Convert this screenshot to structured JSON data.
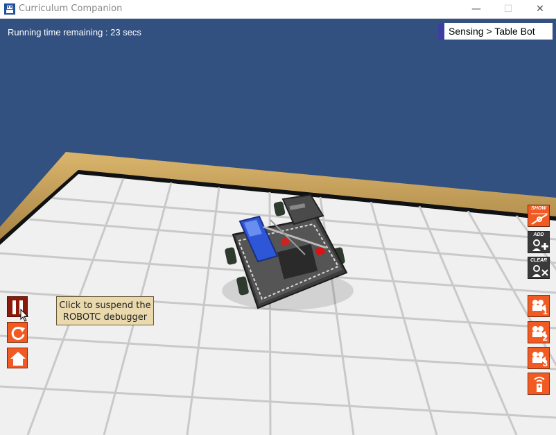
{
  "window": {
    "title": "Curriculum Companion"
  },
  "hud": {
    "timer_text": "Running time remaining : 23 secs",
    "activity_label": "Sensing > Table Bot"
  },
  "right_tools": {
    "show": "SHOW",
    "add": "ADD",
    "clear": "CLEAR",
    "camera_1": "1",
    "camera_2": "2",
    "camera_3": "3"
  },
  "tooltip": {
    "text": "Click to suspend the ROBOTC debugger"
  },
  "colors": {
    "sky": "#325180",
    "tool_orange": "#f15a22",
    "pause_red": "#8b1a0b",
    "table_wood": "#c9a25a",
    "table_surface": "#f2f2f2",
    "activity_accent": "#3b3fa0"
  },
  "icons": [
    "app-icon",
    "minimize-icon",
    "maximize-icon",
    "close-icon",
    "pause-icon",
    "restart-icon",
    "home-icon",
    "show-path-icon",
    "add-robot-icon",
    "clear-robot-icon",
    "camera-1-icon",
    "camera-2-icon",
    "camera-3-icon",
    "remote-control-icon",
    "mouse-cursor-icon"
  ]
}
